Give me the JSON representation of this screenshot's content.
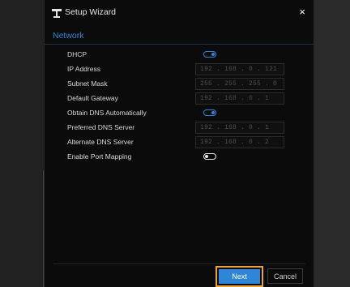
{
  "window": {
    "title": "Setup Wizard",
    "close_symbol": "×"
  },
  "tabs": [
    {
      "label": "Network"
    }
  ],
  "settings": [
    {
      "label": "DHCP",
      "control": "toggle",
      "on": true
    },
    {
      "label": "IP Address",
      "control": "ip",
      "value": "192 . 168 .  0  . 121"
    },
    {
      "label": "Subnet Mask",
      "control": "ip",
      "value": "255 . 255 . 255 .  0"
    },
    {
      "label": "Default Gateway",
      "control": "ip",
      "value": "192 . 168 .  0  .  1"
    },
    {
      "label": "Obtain DNS Automatically",
      "control": "toggle",
      "on": true
    },
    {
      "label": "Preferred DNS Server",
      "control": "ip",
      "value": "192 . 168 .  0  .  1"
    },
    {
      "label": "Alternate DNS Server",
      "control": "ip",
      "value": "192 . 168 .  0  .  2"
    },
    {
      "label": "Enable Port Mapping",
      "control": "toggle",
      "on": false
    }
  ],
  "buttons": {
    "next": "Next",
    "cancel": "Cancel"
  },
  "colors": {
    "accent": "#2f86d6",
    "highlight": "#e8a33a",
    "background": "#0b0b0b"
  }
}
